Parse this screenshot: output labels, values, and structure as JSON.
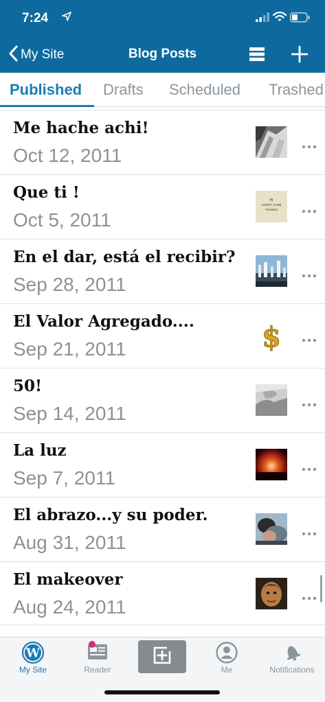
{
  "status": {
    "time": "7:24"
  },
  "nav": {
    "back_label": "My Site",
    "title": "Blog Posts"
  },
  "tabs": [
    {
      "label": "Published"
    },
    {
      "label": "Drafts"
    },
    {
      "label": "Scheduled"
    },
    {
      "label": "Trashed"
    }
  ],
  "posts": [
    {
      "title": "Me hache achi!",
      "date": "Oct 12, 2011"
    },
    {
      "title": "Que ti !",
      "date": "Oct 5, 2011",
      "thumb_text": "HI\nI DON'T CARE\nTHANKS"
    },
    {
      "title": "En el dar, está el recibir?",
      "date": "Sep 28, 2011"
    },
    {
      "title": "El Valor Agregado....",
      "date": "Sep 21, 2011"
    },
    {
      "title": "50!",
      "date": "Sep 14, 2011"
    },
    {
      "title": "La luz",
      "date": "Sep 7, 2011"
    },
    {
      "title": "El abrazo...y su poder.",
      "date": "Aug 31, 2011"
    },
    {
      "title": "El makeover",
      "date": "Aug 24, 2011"
    }
  ],
  "tabbar": {
    "my_site": "My Site",
    "reader": "Reader",
    "me": "Me",
    "notifications": "Notifications"
  },
  "colors": {
    "header": "#0e6a9e",
    "accent": "#1b7bb5",
    "badge": "#d52c82"
  }
}
